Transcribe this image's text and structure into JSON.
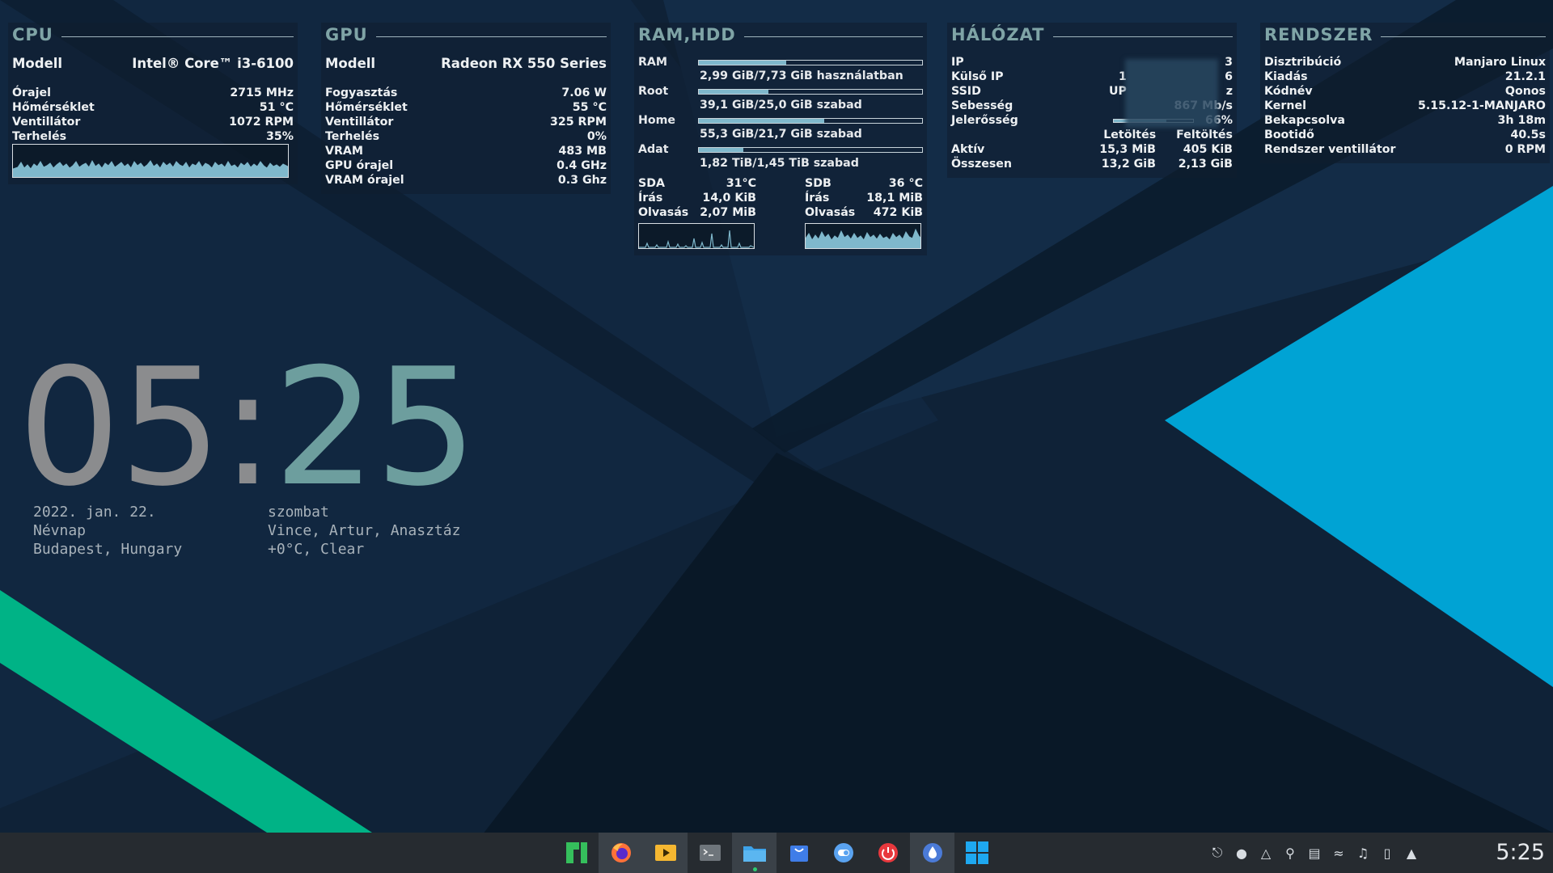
{
  "colors": {
    "background": "#10233a",
    "accent_teal": "#00aa88",
    "accent_blue": "#0ea0d0",
    "panel_title": "#7fa4a6",
    "graph_line": "#7fb8cc"
  },
  "cpu": {
    "title": "CPU",
    "model_label": "Modell",
    "model_value": "Intel® Core™ i3-6100",
    "clock_label": "Órajel",
    "clock_value": "2715 MHz",
    "temp_label": "Hőmérséklet",
    "temp_value": "51 °C",
    "fan_label": "Ventillátor",
    "fan_value": "1072 RPM",
    "load_label": "Terhelés",
    "load_value": "35%"
  },
  "gpu": {
    "title": "GPU",
    "model_label": "Modell",
    "model_value": "Radeon RX 550 Series",
    "power_label": "Fogyasztás",
    "power_value": "7.06 W",
    "temp_label": "Hőmérséklet",
    "temp_value": "55 °C",
    "fan_label": "Ventillátor",
    "fan_value": "325 RPM",
    "load_label": "Terhelés",
    "load_value": "0%",
    "vram_label": "VRAM",
    "vram_value": "483 MB",
    "gpuclock_label": "GPU órajel",
    "gpuclock_value": "0.4 GHz",
    "vramclock_label": "VRAM órajel",
    "vramclock_value": "0.3 Ghz"
  },
  "ramhdd": {
    "title": "RAM,HDD",
    "ram_label": "RAM",
    "ram_text": "2,99 GiB/7,73 GiB használatban",
    "ram_fill": 0.39,
    "root_label": "Root",
    "root_text": "39,1 GiB/25,0 GiB szabad",
    "root_fill": 0.31,
    "home_label": "Home",
    "home_text": "55,3 GiB/21,7 GiB szabad",
    "home_fill": 0.56,
    "data_label": "Adat",
    "data_text": "1,82 TiB/1,45 TiB szabad",
    "data_fill": 0.2,
    "sda": {
      "label": "SDA",
      "temp": "31°C",
      "write_label": "Írás",
      "write_value": "14,0 KiB",
      "read_label": "Olvasás",
      "read_value": "2,07 MiB"
    },
    "sdb": {
      "label": "SDB",
      "temp": "36 °C",
      "write_label": "Írás",
      "write_value": "18,1 MiB",
      "read_label": "Olvasás",
      "read_value": "472 KiB"
    }
  },
  "network": {
    "title": "HÁLÓZAT",
    "ip_label": "IP",
    "ip_value": "3",
    "extip_label": "Külső IP",
    "extip_value": "1",
    "extip_value_right": "6",
    "ssid_label": "SSID",
    "ssid_value": "UP",
    "ssid_value_right": "z",
    "speed_label": "Sebesség",
    "speed_value": "867 Mb/s",
    "signal_label": "Jelerősség",
    "signal_value": "66%",
    "signal_fill": 0.66,
    "download_label": "Letöltés",
    "upload_label": "Feltöltés",
    "active_label": "Aktív",
    "active_down": "15,3 MiB",
    "active_up": "405 KiB",
    "total_label": "Összesen",
    "total_down": "13,2 GiB",
    "total_up": "2,13 GiB"
  },
  "system": {
    "title": "RENDSZER",
    "distro_label": "Disztribúció",
    "distro_value": "Manjaro Linux",
    "release_label": "Kiadás",
    "release_value": "21.2.1",
    "codename_label": "Kódnév",
    "codename_value": "Qonos",
    "kernel_label": "Kernel",
    "kernel_value": "5.15.12-1-MANJARO",
    "uptime_label": "Bekapcsolva",
    "uptime_value": "3h 18m",
    "boot_label": "Bootidő",
    "boot_value": "40.5s",
    "sysfan_label": "Rendszer ventillátor",
    "sysfan_value": "0 RPM"
  },
  "clock": {
    "hours": "05",
    "separator": ":",
    "minutes": "25"
  },
  "info_left": {
    "date": "2022. jan. 22.",
    "nameday_label": "Névnap",
    "location": "Budapest, Hungary"
  },
  "info_right": {
    "weekday": "szombat",
    "names": "Vince, Artur, Anasztáz",
    "weather": "+0°C, Clear"
  },
  "taskbar": {
    "icons": [
      "manjaro-icon",
      "firefox-icon",
      "media-player-icon",
      "terminal-icon",
      "file-manager-icon",
      "software-store-icon",
      "toggle-app-icon",
      "power-icon",
      "drop-app-icon",
      "windows-icon"
    ],
    "tray_icons": [
      "update-icon",
      "drop-icon",
      "vlc-icon",
      "location-icon",
      "clipboard-icon",
      "wifi-icon",
      "volume-icon",
      "battery-icon",
      "expand-arrow-icon"
    ],
    "time": "5:25"
  }
}
